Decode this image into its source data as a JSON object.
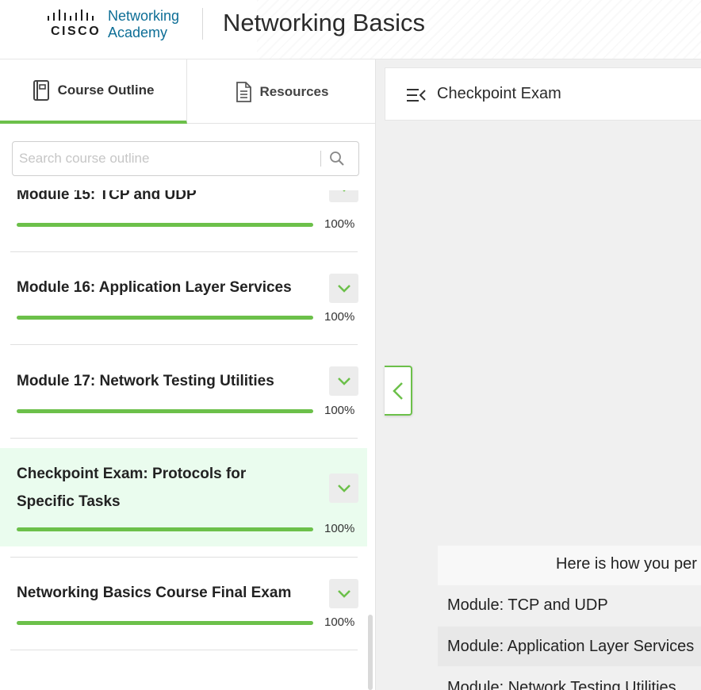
{
  "header": {
    "logo_brand": "CISCO",
    "logo_line1": "Networking",
    "logo_line2": "Academy",
    "course_title": "Networking Basics"
  },
  "sidebar": {
    "tabs": [
      {
        "label": "Course Outline",
        "icon": "book-icon",
        "active": true
      },
      {
        "label": "Resources",
        "icon": "document-icon",
        "active": false
      }
    ],
    "search": {
      "placeholder": "Search course outline",
      "value": ""
    },
    "modules": [
      {
        "title": "Module 15: TCP and UDP",
        "progress_pct": 100,
        "progress_label": "100%"
      },
      {
        "title": "Module 16: Application Layer Services",
        "progress_pct": 100,
        "progress_label": "100%"
      },
      {
        "title": "Module 17: Network Testing Utilities",
        "progress_pct": 100,
        "progress_label": "100%"
      },
      {
        "title_line1": "Checkpoint Exam: Protocols for",
        "title_line2": "Specific Tasks",
        "progress_pct": 100,
        "progress_label": "100%",
        "active": true
      },
      {
        "title": "Networking Basics Course Final Exam",
        "progress_pct": 100,
        "progress_label": "100%"
      }
    ]
  },
  "main": {
    "title": "Checkpoint Exam",
    "results_heading": "Here is how you per",
    "results_rows": [
      "Module: TCP and UDP",
      "Module: Application Layer Services",
      "Module: Network Testing Utilities"
    ]
  },
  "colors": {
    "accent_green": "#6cc04a",
    "active_row_bg": "#eafcee",
    "brand_blue": "#0d6e96"
  }
}
